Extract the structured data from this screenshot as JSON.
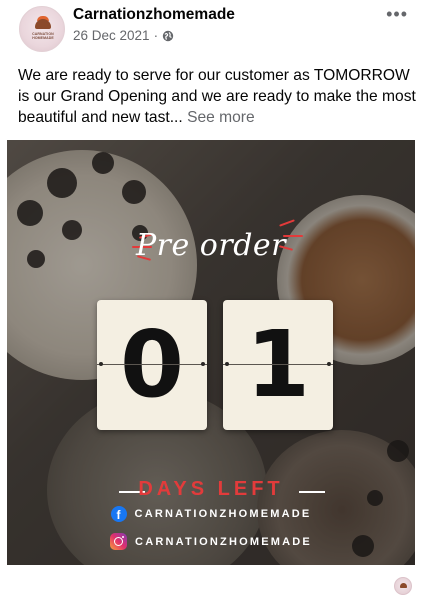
{
  "post": {
    "author": "Carnationzhomemade",
    "date": "26 Dec 2021",
    "date_separator": "·",
    "privacy_icon": "globe-icon",
    "more_label": "•••",
    "text": "We are ready to serve for our customer as TOMORROW is our Grand Opening and we are ready to make the most beautiful and new tast...",
    "see_more": "See more",
    "avatar_logo_text": "CARNATION HOMEMADE"
  },
  "poster": {
    "title": "Pre order",
    "digits": [
      "0",
      "1"
    ],
    "caption": "DAYS LEFT",
    "facebook_handle": "CARNATIONZHOMEMADE",
    "instagram_handle": "CARNATIONZHOMEMADE",
    "accent_color": "#e23b3b",
    "icons": [
      "facebook-icon",
      "instagram-icon"
    ]
  }
}
